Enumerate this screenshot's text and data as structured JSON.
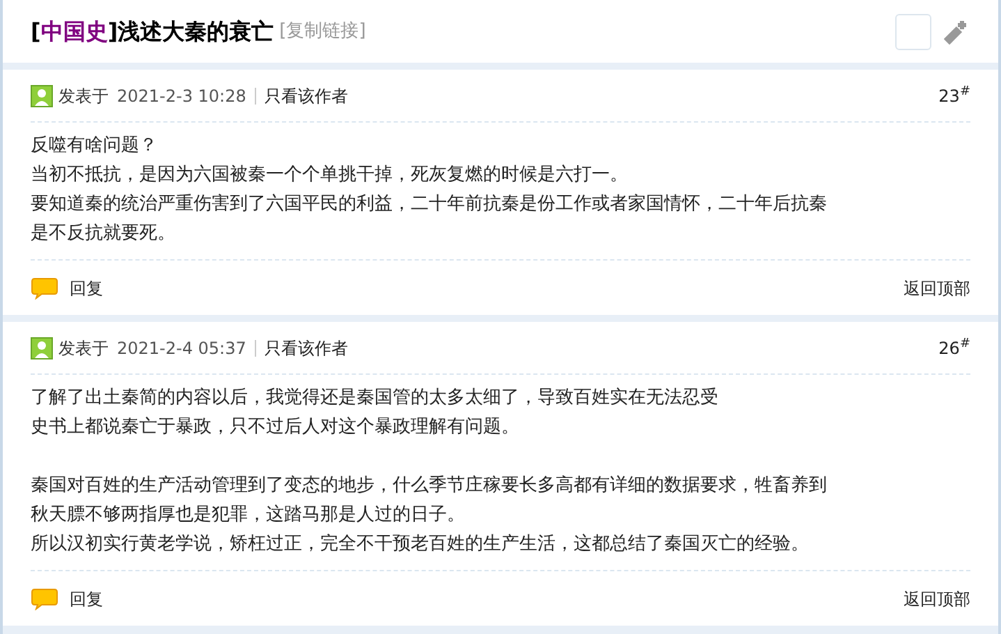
{
  "thread": {
    "bracket_open": "[",
    "category": "中国史",
    "bracket_close": "]",
    "title": "浅述大秦的衰亡",
    "copy_link": "[复制链接]"
  },
  "posts": [
    {
      "posted": "发表于",
      "time": "2021-2-3 10:28",
      "author_only": "只看该作者",
      "floor": "23$^{#}$",
      "paragraphs": [
        [
          "反噬有啥问题？",
          "当初不抵抗，是因为六国被秦一个个单挑干掉，死灰复燃的时候是六打一。",
          "要知道秦的统治严重伤害到了六国平民的利益，二十年前抗秦是份工作或者家国情怀，二十年后抗秦",
          "是不反抗就要死。"
        ]
      ],
      "reply": "回复",
      "back_to_top": "返回顶部"
    },
    {
      "posted": "发表于",
      "time": "2021-2-4 05:37",
      "author_only": "只看该作者",
      "floor": "26$^{#}$",
      "paragraphs": [
        [
          "了解了出土秦简的内容以后，我觉得还是秦国管的太多太细了，导致百姓实在无法忍受",
          "史书上都说秦亡于暴政，只不过后人对这个暴政理解有问题。"
        ],
        [
          "秦国对百姓的生产活动管理到了变态的地步，什么季节庄稼要长多高都有详细的数据要求，牲畜养到",
          "秋天膘不够两指厚也是犯罪，这踏马那是人过的日子。",
          "所以汉初实行黄老学说，矫枉过正，完全不干预老百姓的生产生活，这都总结了秦国灭亡的经验。"
        ]
      ],
      "reply": "回复",
      "back_to_top": "返回顶部"
    }
  ]
}
